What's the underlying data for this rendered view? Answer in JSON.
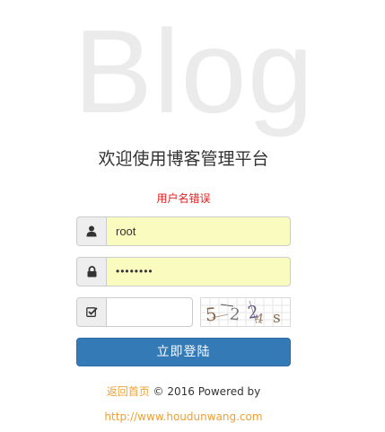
{
  "background_word": "Blog",
  "title": "欢迎使用博客管理平台",
  "error_message": "用户名错误",
  "form": {
    "username": {
      "icon": "user-icon",
      "value": "root"
    },
    "password": {
      "icon": "lock-icon",
      "value_masked": "••••••••"
    },
    "captcha": {
      "icon": "checkbox-icon",
      "value": "",
      "image_text": "5224s"
    }
  },
  "login_button": "立即登陆",
  "footer": {
    "home_link": "返回首页",
    "copyright": " © 2016 Powered by",
    "site_link": "http://www.houdunwang.com"
  },
  "colors": {
    "primary": "#337ab7",
    "error": "#e02020",
    "link": "#f0a035",
    "autofill": "#fafbbe"
  }
}
